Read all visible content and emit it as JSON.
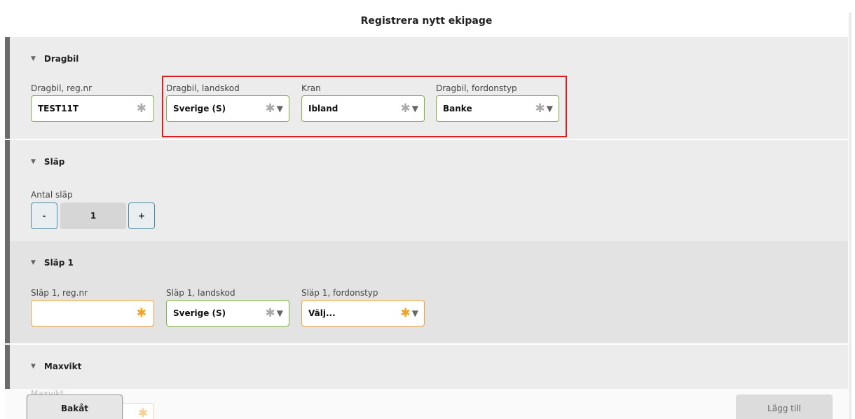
{
  "page_title": "Registrera nytt ekipage",
  "sections": {
    "dragbil": {
      "title": "Dragbil",
      "fields": {
        "regnr": {
          "label": "Dragbil, reg.nr",
          "value": "TEST11T"
        },
        "landskod": {
          "label": "Dragbil, landskod",
          "value": "Sverige (S)"
        },
        "kran": {
          "label": "Kran",
          "value": "Ibland"
        },
        "fordonstyp": {
          "label": "Dragbil, fordonstyp",
          "value": "Banke"
        }
      }
    },
    "slap": {
      "title": "Släp",
      "antal": {
        "label": "Antal släp",
        "minus": "-",
        "value": "1",
        "plus": "+"
      }
    },
    "slap1": {
      "title": "Släp 1",
      "fields": {
        "regnr": {
          "label": "Släp 1, reg.nr",
          "value": ""
        },
        "landskod": {
          "label": "Släp 1, landskod",
          "value": "Sverige (S)"
        },
        "fordonstyp": {
          "label": "Släp 1, fordonstyp",
          "value": "Välj..."
        }
      }
    },
    "maxvikt": {
      "title": "Maxvikt",
      "field_label": "Maxvikt ..."
    }
  },
  "icons": {
    "required": "✱",
    "dropdown": "▼",
    "collapse": "▼"
  },
  "colors": {
    "valid_border": "#7cb342",
    "required_border": "#f0a33a",
    "highlight": "#e01b24",
    "stripe": "#6b6b6b"
  },
  "footer": {
    "back_label": "Bakåt",
    "add_label": "Lägg till"
  }
}
